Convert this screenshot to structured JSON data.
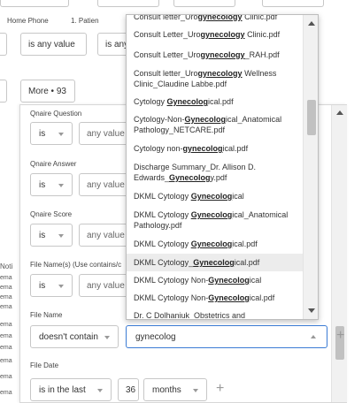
{
  "background": {
    "header_labels": [
      "Home Phone",
      "1. Patien"
    ],
    "home_phone_value": "is any value",
    "patient_value": "is any",
    "more_button": "More • 93",
    "left_fragments": [
      "Noti",
      "ema",
      "ema",
      "ema",
      "ema",
      "ema",
      "ema",
      "ema",
      "ema",
      "ema",
      "ema"
    ]
  },
  "filters": [
    {
      "label": "Qnaire Question",
      "op": "is",
      "value": "any value"
    },
    {
      "label": "Qnaire Answer",
      "op": "is",
      "value": "any value"
    },
    {
      "label": "Qnaire Score",
      "op": "is",
      "value": "any value"
    },
    {
      "label": "File Name(s) (Use contains/c",
      "op": "is",
      "value": "any value"
    }
  ],
  "file_name": {
    "label": "File Name",
    "op": "doesn't contain",
    "search_value": "gynecolog"
  },
  "file_date": {
    "label": "File Date",
    "op": "is in the last",
    "number": "36",
    "unit": "months"
  },
  "dropdown": {
    "highlight_term": "Gynecolog",
    "items": [
      {
        "pre": "Consult letter_Uro",
        "match": "gynecology",
        "post": " Clinic.pdf",
        "lines": 1
      },
      {
        "pre": "Consult Letter_Uro",
        "match": "gynecology",
        "post": " Clinic.pdf",
        "lines": 1
      },
      {
        "pre": "Consult Letter_Uro",
        "match": "gynecology",
        "post": "_RAH.pdf",
        "lines": 1
      },
      {
        "pre": "Consult letter_Uro",
        "match": "gynecology",
        "post": " Wellness Clinic_Claudine Labbe.pdf",
        "lines": 2
      },
      {
        "pre": "Cytology ",
        "match": "Gynecolog",
        "post": "ical.pdf",
        "lines": 1
      },
      {
        "pre": "Cytology-Non-",
        "match": "Gynecolog",
        "post": "ical_Anatomical Pathology_NETCARE.pdf",
        "lines": 2
      },
      {
        "pre": "Cytology non-",
        "match": "gynecolog",
        "post": "ical.pdf",
        "lines": 1
      },
      {
        "pre": "Discharge Summary_Dr. Allison D. Edwards_",
        "match": "Gynecolog",
        "post": "y.pdf",
        "lines": 2
      },
      {
        "pre": "DKML Cytology ",
        "match": "Gynecolog",
        "post": "ical",
        "lines": 1
      },
      {
        "pre": "DKML Cytology ",
        "match": "Gynecolog",
        "post": "ical_Anatomical Pathology.pdf",
        "lines": 2
      },
      {
        "pre": "DKML Cytology ",
        "match": "Gynecolog",
        "post": "ical.pdf",
        "lines": 1
      },
      {
        "pre": "DKML Cytology_",
        "match": "Gynecolog",
        "post": "ical.pdf",
        "lines": 1
      },
      {
        "pre": "DKML Cytology Non-",
        "match": "Gynecolog",
        "post": "ical",
        "lines": 1
      },
      {
        "pre": "DKML Cytology Non-",
        "match": "Gynecolog",
        "post": "ical.pdf",
        "lines": 1
      },
      {
        "pre": "Dr. C Dolhaniuk_Obstetrics and",
        "match": "",
        "post": "",
        "lines": 1
      }
    ]
  }
}
